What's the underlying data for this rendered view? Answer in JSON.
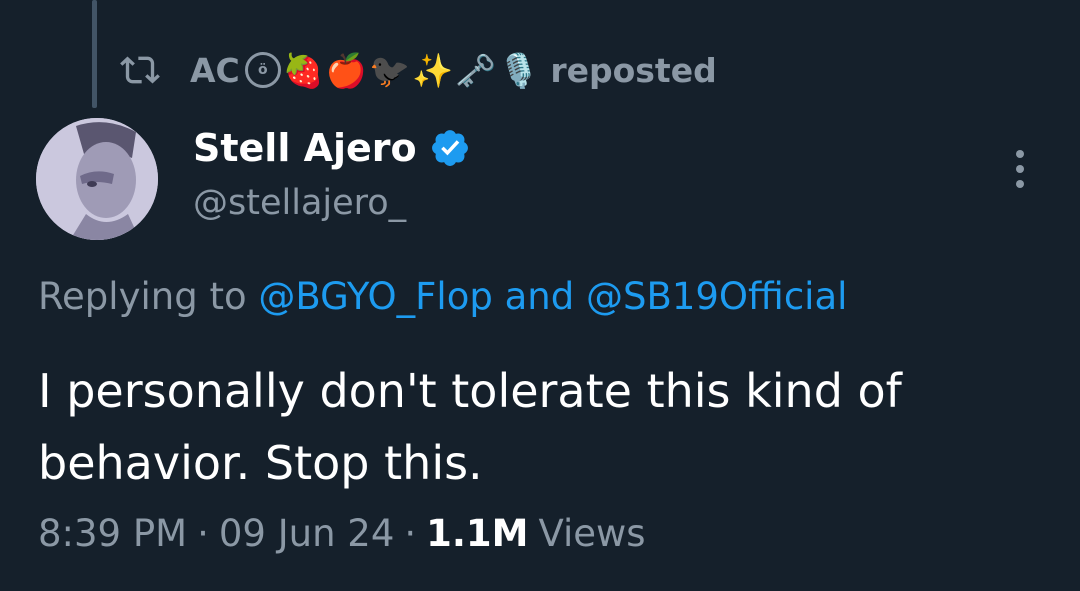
{
  "repost": {
    "reposter_name": "AC",
    "reposter_emojis": [
      "ö",
      "🍓",
      "🍎",
      "🐦‍⬛",
      "✨",
      "🗝️",
      "🎙️"
    ],
    "label": "reposted",
    "icon": "repost-icon"
  },
  "author": {
    "display_name": "Stell Ajero",
    "handle": "@stellajero_",
    "verified": true,
    "verified_color": "#1d9bf0",
    "avatar_icon": "profile-photo"
  },
  "more_icon": "more-vertical-icon",
  "reply_context": {
    "prefix": "Replying to",
    "mention_1": "@BGYO_Flop",
    "joiner": "and",
    "mention_2": "@SB19Official"
  },
  "tweet": {
    "line_1": "I personally don't tolerate this kind of",
    "line_2": "behavior. Stop this."
  },
  "meta": {
    "time": "8:39 PM",
    "separator": "·",
    "date": "09 Jun 24",
    "views_count": "1.1M",
    "views_label": "Views"
  },
  "colors": {
    "background": "#15202b",
    "secondary_text": "#8b98a5",
    "link": "#1d9bf0",
    "primary_text": "#ffffff"
  }
}
